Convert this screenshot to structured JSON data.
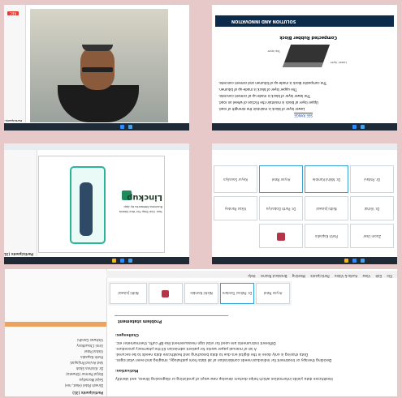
{
  "tiles": {
    "top_left": {
      "participants_header": "Participants (31)",
      "rec_badge": "REC"
    },
    "top_right": {
      "header_title": "SOLUTION AND INNOVATION",
      "slide_title": "Compacted Rubber Block",
      "slide_label_a": "Top layer",
      "slide_label_b": "Lower layer",
      "bullets": [
        "The composite block is made-up of bitumen and cement concrete.",
        "The upper layer of block is made-up of bitumen.",
        "The lower layer of block is made-up of cement concrete.",
        "Upper layer of block is maintain the friction of wheel on road.",
        "Lower layer of block is maintain the strength of road."
      ],
      "link_text": "SEE RANGE"
    },
    "middle_left": {
      "participants_header": "Participants (31)",
      "brand": "Linckup",
      "tagline": "Business Networks by App",
      "subtitle": "Your One Stop For Your Needs"
    },
    "middle_right": {
      "tiles": [
        {
          "name": "Keyur Savaliya"
        },
        {
          "name": "Aryan Patel"
        },
        {
          "name": "Dr. Nikhil Kamble"
        },
        {
          "name": "Dr. Pallavi"
        },
        {
          "name": "Vikas Pandey"
        },
        {
          "name": "Dr. Parth Dobariya"
        },
        {
          "name": "Nidhi Jaiswal"
        },
        {
          "name": "Dr. Vishal"
        },
        {
          "name": "Parth Kapadia"
        },
        {
          "name": "Zoom User"
        }
      ]
    },
    "bottom": {
      "menu": [
        "File",
        "Edit",
        "View",
        "Audio & Video",
        "Participants",
        "Meeting",
        "Breakout Rooms",
        "Help"
      ],
      "participants_header": "Participants (31)",
      "participants": [
        "Dinesh Patel (Host, me)",
        "Sejal Moradiya",
        "Binjal Parmar (Shweta)",
        "Dr. Krishna Shah",
        "Ved Arvind Prajapati",
        "Parth Kapadia",
        "Vishal Patel",
        "Urmi Chaudhary",
        "Vishwas Gandhi"
      ],
      "thumbs": [
        {
          "name": "Aryan Patel"
        },
        {
          "name": "Dr. Pallavi Tondare"
        },
        {
          "name": "Nikhil Kamble"
        },
        {
          "name": ""
        },
        {
          "name": "Nidhi Jaiswal"
        }
      ],
      "section_title": "Problem statement",
      "challenges_label": "Challenges:",
      "challenges": [
        "Different instruments are used for vital sign measurement like BP cuffs, thermometer etc.",
        "A lot of manual paper works for patient admission till the pharmacy procedure.",
        "Data sharing is only done in the digital era due to data breaching and healthcare data needs to be secured.",
        "Deciding therapy or treatment for individual needs combination of all data from pathology, imaging and even vital signs."
      ],
      "motivation_label": "Motivation:",
      "motivation": [
        "Healthcare data yields information which helps doctors develop new ways of predicting or diagnosing illness, and identify"
      ]
    }
  }
}
